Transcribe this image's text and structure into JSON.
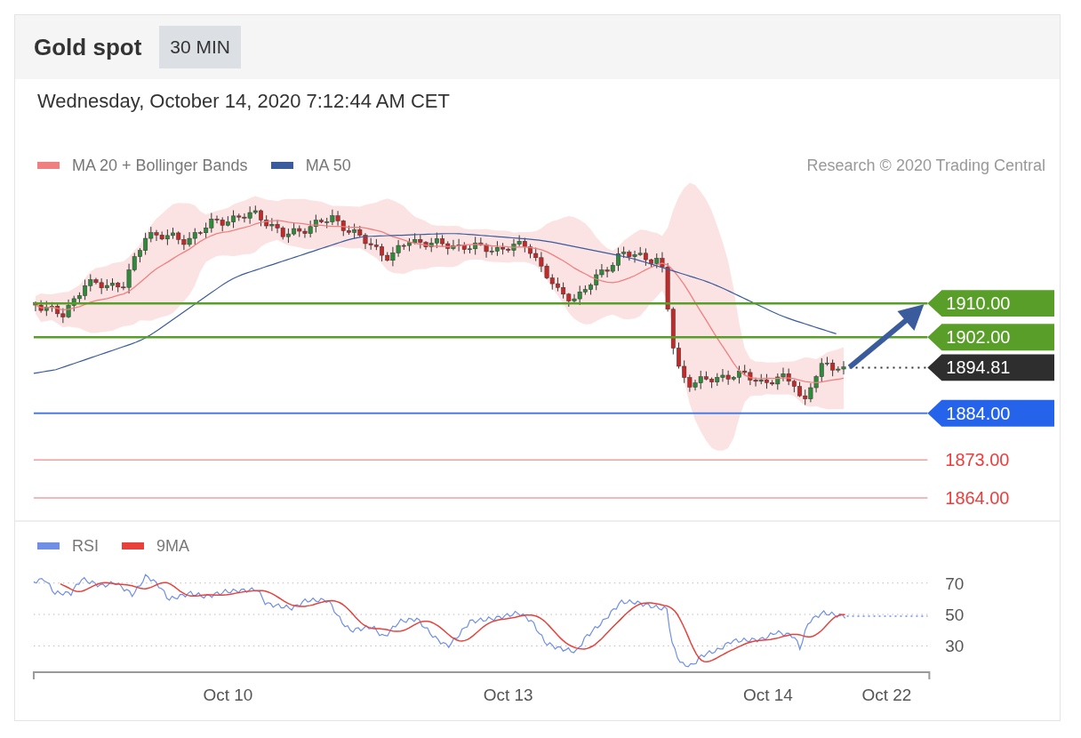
{
  "header": {
    "title": "Gold spot",
    "interval": "30 MIN"
  },
  "timestamp": "Wednesday, October 14, 2020 7:12:44 AM CET",
  "price_chart": {
    "legend": [
      {
        "label": "MA 20 + Bollinger Bands",
        "color": "#f08080"
      },
      {
        "label": "MA 50",
        "color": "#3a5c9c"
      }
    ],
    "credit": "Research © 2020 Trading Central",
    "levels": [
      {
        "value": "1910.00",
        "kind": "resistance"
      },
      {
        "value": "1902.00",
        "kind": "resistance"
      },
      {
        "value": "1894.81",
        "kind": "last"
      },
      {
        "value": "1884.00",
        "kind": "pivot"
      },
      {
        "value": "1873.00",
        "kind": "support"
      },
      {
        "value": "1864.00",
        "kind": "support"
      }
    ]
  },
  "rsi_chart": {
    "legend": [
      {
        "label": "RSI",
        "color": "#6f8fe6"
      },
      {
        "label": "9MA",
        "color": "#e8403a"
      }
    ],
    "y_ticks": [
      "70",
      "50",
      "30"
    ],
    "x_labels": [
      "Oct 10",
      "Oct 13",
      "Oct 14",
      "Oct 22"
    ]
  }
}
